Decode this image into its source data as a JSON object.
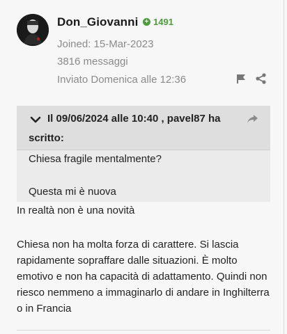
{
  "post": {
    "author": "Don_Giovanni",
    "reputation": "1491",
    "joined": "Joined: 15-Mar-2023",
    "messages": "3816 messaggi",
    "sent": "Inviato Domenica alle 12:36"
  },
  "quote": {
    "header_line1": "Il 09/06/2024 alle 10:40 , pavel87 ha",
    "header_line2": "scritto:",
    "text1": "Chiesa fragile mentalmente?",
    "text2": "Questa mi è nuova"
  },
  "body": {
    "line1": "In realtà non è una novità",
    "line2": "Chiesa non ha molta forza di carattere. Si lascia",
    "line3": "rapidamente sopraffare dalle situazioni. È molto",
    "line4": "emotivo e non ha capacità di adattamento. Quindi non",
    "line5": "riesco nemmeno a immaginarlo di andare in Inghilterra",
    "line6": "o in Francia"
  },
  "icons": {
    "reputation": "plus-circle-icon",
    "report": "flag-icon",
    "share": "share-icon",
    "quote_toggle": "chevron-down-icon",
    "go_to_quote": "share-forward-icon"
  },
  "colors": {
    "reputation": "#4f9a3d",
    "meta": "#8a8a8a",
    "quote_header": "#dedede",
    "quote_body": "#ebebeb"
  }
}
